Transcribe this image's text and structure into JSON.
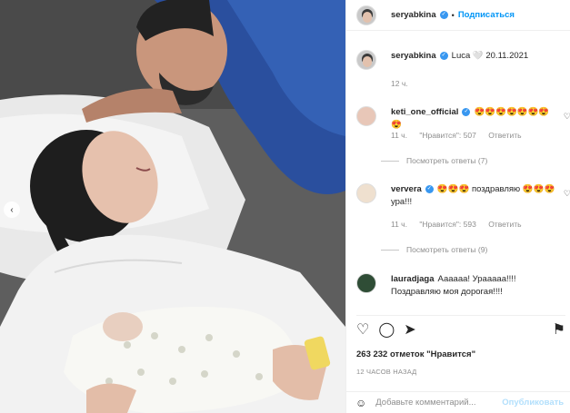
{
  "photo": {
    "alt_icon": "image-placeholder",
    "prev_icon": "‹"
  },
  "header": {
    "username": "seryabkina",
    "verified_icon": "✓",
    "separator": "•",
    "follow_label": "Подписаться",
    "more_icon": "⋯"
  },
  "caption": {
    "username": "seryabkina",
    "text": "Luca 🤍 20.11.2021",
    "time": "12 ч."
  },
  "comments": [
    {
      "username": "keti_one_official",
      "text": "😍😍😍😍😍😍😍😍",
      "time": "11 ч.",
      "likes": "\"Нравится\": 507",
      "reply": "Ответить",
      "view_replies": "Посмотреть ответы (7)"
    },
    {
      "username": "ververa",
      "text": "😍😍😍 поздравляю 😍😍😍 ура!!!",
      "time": "11 ч.",
      "likes": "\"Нравится\": 593",
      "reply": "Ответить",
      "view_replies": "Посмотреть ответы (9)"
    },
    {
      "username": "lauradjaga",
      "text": "Аааааа! Урааааа!!!! Поздравляю моя дорогая!!!!"
    }
  ],
  "actions": {
    "like_icon": "♡",
    "comment_icon": "◯",
    "share_icon": "➤",
    "save_icon": "⚑"
  },
  "likes_text": "263 232 отметок \"Нравится\"",
  "posted_time": "12 ЧАСОВ НАЗАД",
  "add_comment": {
    "emoji_icon": "☺",
    "placeholder": "Добавьте комментарий...",
    "publish_label": "Опубликовать"
  },
  "colors": {
    "accent": "#0095f6",
    "verified": "#3897f0",
    "muted": "#8e8e8e",
    "publish_disabled": "#b2dffc"
  }
}
